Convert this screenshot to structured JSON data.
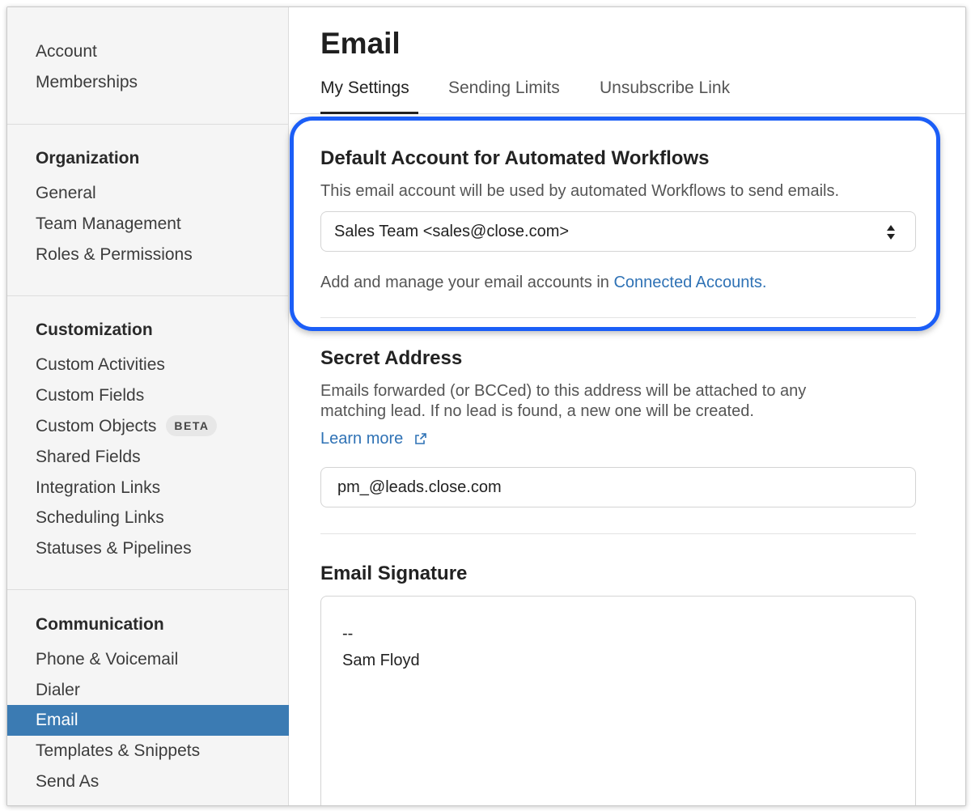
{
  "sidebar": {
    "top_items": [
      "Account",
      "Memberships"
    ],
    "organization": {
      "heading": "Organization",
      "items": [
        "General",
        "Team Management",
        "Roles & Permissions"
      ]
    },
    "customization": {
      "heading": "Customization",
      "items": [
        "Custom Activities",
        "Custom Fields",
        "Custom Objects",
        "Shared Fields",
        "Integration Links",
        "Scheduling Links",
        "Statuses & Pipelines"
      ],
      "badge": "BETA"
    },
    "communication": {
      "heading": "Communication",
      "items": [
        "Phone & Voicemail",
        "Dialer",
        "Email",
        "Templates & Snippets",
        "Send As"
      ],
      "active_item": "Email"
    }
  },
  "main": {
    "title": "Email",
    "tabs": [
      "My Settings",
      "Sending Limits",
      "Unsubscribe Link"
    ],
    "active_tab": "My Settings",
    "default_account": {
      "title": "Default Account for Automated Workflows",
      "description": "This email account will be used by automated Workflows to send emails.",
      "selected_value": "Sales Team <sales@close.com>",
      "note_prefix": "Add and manage your email accounts in ",
      "note_link": "Connected Accounts."
    },
    "secret_address": {
      "title": "Secret Address",
      "description_line1": "Emails forwarded (or BCCed) to this address will be attached to any",
      "description_line2": "matching lead. If no lead is found, a new one will be created.",
      "learn_more": "Learn more",
      "value": "pm_@leads.close.com"
    },
    "signature": {
      "title": "Email Signature",
      "line1": "--",
      "line2": "Sam Floyd"
    }
  },
  "colors": {
    "accent": "#3b7bb3",
    "link": "#2f72b5",
    "highlight": "#1b5ef7"
  }
}
